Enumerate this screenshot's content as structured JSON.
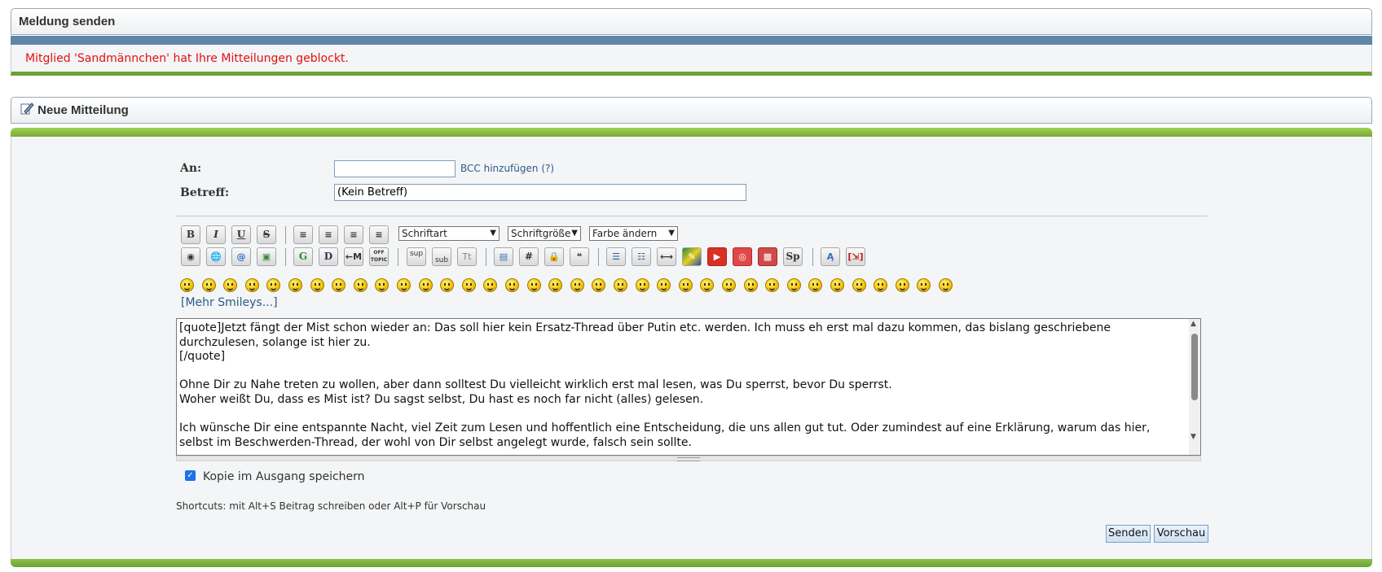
{
  "header1": {
    "title": "Meldung senden"
  },
  "notice": {
    "text": "Mitglied 'Sandmännchen' hat Ihre Mitteilungen geblockt."
  },
  "header2": {
    "title": "Neue Mitteilung",
    "icon": "pen-paper-icon"
  },
  "form": {
    "to_label": "An:",
    "to_value": "",
    "bcc_link": "BCC hinzufügen",
    "bcc_help": "(?)",
    "subject_label": "Betreff:",
    "subject_value": "(Kein Betreff)"
  },
  "toolbar": {
    "font_select": "Schriftart",
    "size_select": "Schriftgröße",
    "color_select": "Farbe ändern",
    "bold": "B",
    "italic": "I",
    "underline": "U",
    "strike": "S",
    "sup": "sup",
    "sub": "sub",
    "tt": "Tt",
    "hash": "#",
    "google": "G",
    "dict": "D",
    "move": "←M",
    "offtopic": "OFF TOPIC",
    "spoiler": "Sp"
  },
  "smileys": {
    "more_link": "[Mehr Smileys...]",
    "count": 36
  },
  "editor": {
    "text": "[quote]Jetzt fängt der Mist schon wieder an: Das soll hier kein Ersatz-Thread über Putin etc. werden. Ich muss eh erst mal dazu kommen, das bislang geschriebene durchzulesen, solange ist hier zu.\n[/quote]\n\nOhne Dir zu Nahe treten zu wollen, aber dann solltest Du vielleicht wirklich erst mal lesen, was Du sperrst, bevor Du sperrst.\nWoher weißt Du, dass es Mist ist? Du sagst selbst, Du hast es noch far nicht (alles) gelesen.\n\nIch wünsche Dir eine entspannte Nacht, viel Zeit zum Lesen und hoffentlich eine Entscheidung, die uns allen gut tut. Oder zumindest auf eine Erklärung, warum das hier, selbst im Beschwerden-Thread, der wohl von Dir selbst angelegt wurde, falsch sein sollte."
  },
  "options": {
    "save_copy_label": "Kopie im Ausgang speichern",
    "save_copy_checked": true
  },
  "shortcuts": {
    "text": "Shortcuts: mit Alt+S Beitrag schreiben oder Alt+P für Vorschau"
  },
  "buttons": {
    "send": "Senden",
    "preview": "Vorschau"
  }
}
